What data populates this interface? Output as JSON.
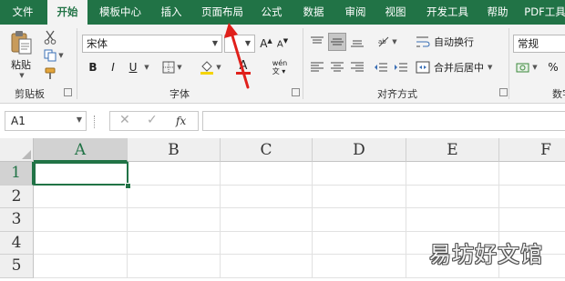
{
  "tabs": [
    {
      "label": "文件",
      "active": false
    },
    {
      "label": "开始",
      "active": true
    },
    {
      "label": "模板中心",
      "active": false
    },
    {
      "label": "插入",
      "active": false
    },
    {
      "label": "页面布局",
      "active": false
    },
    {
      "label": "公式",
      "active": false
    },
    {
      "label": "数据",
      "active": false
    },
    {
      "label": "审阅",
      "active": false
    },
    {
      "label": "视图",
      "active": false
    },
    {
      "label": "开发工具",
      "active": false
    },
    {
      "label": "帮助",
      "active": false
    },
    {
      "label": "PDF工具",
      "active": false
    }
  ],
  "ribbon": {
    "clipboard": {
      "paste_label": "粘贴",
      "group_label": "剪贴板"
    },
    "font": {
      "font_name": "宋体",
      "font_size": "",
      "bold": "B",
      "italic": "I",
      "underline": "U",
      "font_color_letter": "A",
      "group_label": "字体"
    },
    "alignment": {
      "wrap_text": "自动换行",
      "merge_center": "合并后居中",
      "group_label": "对齐方式"
    },
    "number": {
      "format": "常规",
      "percent": "%",
      "group_label": "数字"
    }
  },
  "formula_bar": {
    "name_box": "A1",
    "fx": "fx",
    "value": ""
  },
  "sheet": {
    "columns": [
      "A",
      "B",
      "C",
      "D",
      "E",
      "F"
    ],
    "rows": [
      "1",
      "2",
      "3",
      "4",
      "5"
    ],
    "selected_cell": "A1"
  },
  "colors": {
    "accent": "#217346",
    "annotation_arrow": "#e0201b"
  },
  "watermark": "易坊好文馆"
}
